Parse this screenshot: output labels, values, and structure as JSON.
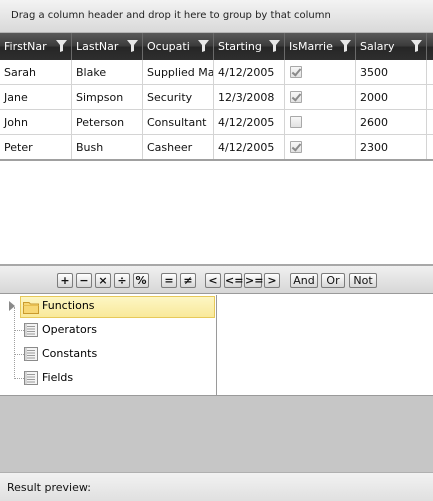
{
  "group_panel": {
    "hint": "Drag a column header and drop it here to group by that column"
  },
  "grid": {
    "columns": [
      {
        "label": "FirstNar",
        "width": 72
      },
      {
        "label": "LastNar",
        "width": 71
      },
      {
        "label": "Ocupati",
        "width": 71
      },
      {
        "label": "Starting",
        "width": 71
      },
      {
        "label": "IsMarrie",
        "width": 71
      },
      {
        "label": "Salary",
        "width": 71
      }
    ],
    "rows": [
      {
        "first": "Sarah",
        "last": "Blake",
        "occupation": "Supplied Ma",
        "starting": "4/12/2005",
        "married": true,
        "salary": "3500"
      },
      {
        "first": "Jane",
        "last": "Simpson",
        "occupation": "Security",
        "starting": "12/3/2008",
        "married": true,
        "salary": "2000"
      },
      {
        "first": "John",
        "last": "Peterson",
        "occupation": "Consultant",
        "starting": "4/12/2005",
        "married": false,
        "salary": "2600"
      },
      {
        "first": "Peter",
        "last": "Bush",
        "occupation": "Casheer",
        "starting": "4/12/2005",
        "married": true,
        "salary": "2300"
      }
    ]
  },
  "toolbar": {
    "plus": "+",
    "minus": "−",
    "multiply": "×",
    "divide": "÷",
    "percent": "%",
    "equals": "=",
    "not_equals": "≠",
    "less": "<",
    "less_equal": "<=",
    "greater_equal": ">=",
    "greater": ">",
    "and": "And",
    "or": "Or",
    "not": "Not"
  },
  "tree": {
    "items": [
      {
        "label": "Functions",
        "icon": "folder-icon",
        "selected": true
      },
      {
        "label": "Operators",
        "icon": "list-icon"
      },
      {
        "label": "Constants",
        "icon": "list-icon"
      },
      {
        "label": "Fields",
        "icon": "list-icon"
      }
    ]
  },
  "result": {
    "label": "Result preview:"
  },
  "colors": {
    "header_dark": "#2e2e2e",
    "selection": "#f9e99a",
    "result_bg": "#c6c6c6"
  }
}
